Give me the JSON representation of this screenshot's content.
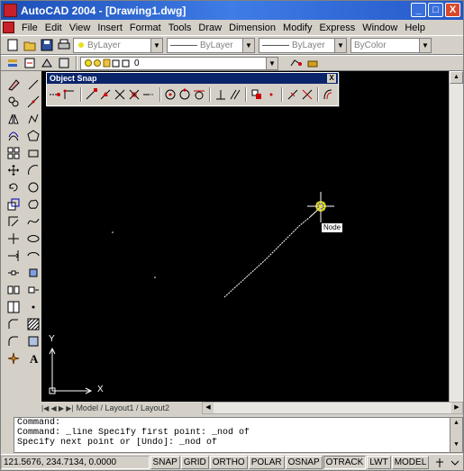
{
  "window": {
    "title": "AutoCAD 2004 - [Drawing1.dwg]"
  },
  "title_buttons": {
    "minimize": "_",
    "maximize": "□",
    "close": "X"
  },
  "menu": [
    "File",
    "Edit",
    "View",
    "Insert",
    "Format",
    "Tools",
    "Draw",
    "Dimension",
    "Modify",
    "Express",
    "Window",
    "Help"
  ],
  "properties": {
    "layer": "ByLayer",
    "linetype": "ByLayer",
    "lineweight": "ByLayer",
    "color": "ByColor",
    "layer_name": "0"
  },
  "object_snap": {
    "title": "Object Snap",
    "close": "X"
  },
  "tooltip": {
    "text": "Node"
  },
  "canvas": {
    "x_axis": "X",
    "y_axis": "Y",
    "tabs": "Model / Layout1 / Layout2"
  },
  "command": {
    "lines": [
      "Command:",
      "Command: _line Specify first point: _nod of",
      "Specify next point or [Undo]: _nod of"
    ]
  },
  "status": {
    "coords": "121.5676, 234.7134, 0.0000",
    "buttons": [
      "SNAP",
      "GRID",
      "ORTHO",
      "POLAR",
      "OSNAP",
      "OTRACK",
      "LWT",
      "MODEL"
    ]
  },
  "colors": {
    "canvas": "#000000",
    "title_bar": "#2458c8",
    "snap_title": "#0a246a",
    "line": "#ffffff",
    "marker": "#e8e020"
  }
}
